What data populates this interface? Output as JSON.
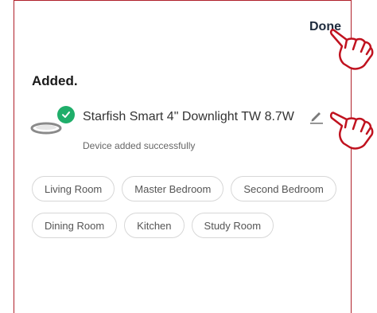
{
  "header": {
    "done_label": "Done"
  },
  "title": "Added.",
  "device": {
    "name": "Starfish Smart 4\" Downlight TW 8.7W",
    "status": "Device added successfully"
  },
  "rooms": [
    [
      "Living Room",
      "Master Bedroom",
      "Second Bedroom"
    ],
    [
      "Dining Room",
      "Kitchen",
      "Study Room"
    ]
  ],
  "colors": {
    "accent_check": "#1fae6a",
    "frame_border": "#b0202a",
    "pointer_hand": "#c0121f"
  }
}
